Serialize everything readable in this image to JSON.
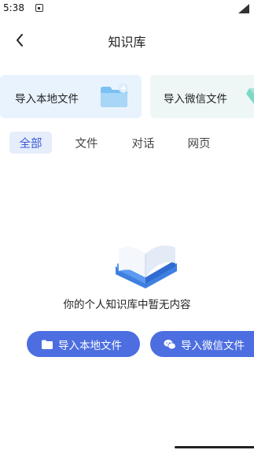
{
  "status_bar": {
    "time": "5:38"
  },
  "header": {
    "title": "知识库"
  },
  "import_cards": {
    "local_label": "导入本地文件",
    "wechat_label": "导入微信文件"
  },
  "tabs": [
    {
      "label": "全部",
      "selected": true
    },
    {
      "label": "文件",
      "selected": false
    },
    {
      "label": "对话",
      "selected": false
    },
    {
      "label": "网页",
      "selected": false
    }
  ],
  "empty_state": {
    "message": "你的个人知识库中暂无内容",
    "local_button": "导入本地文件",
    "wechat_button": "导入微信文件"
  },
  "colors": {
    "accent": "#4c6ee0",
    "tab_selected_bg": "#e6edfb",
    "tab_selected_text": "#3b5bd6",
    "card_local_bg": "#e9f3fd",
    "card_wechat_bg": "#eef7f6"
  },
  "icons": {
    "back": "chevron-left-icon",
    "card_local": "folder-plus-icon",
    "card_wechat": "wechat-gem-icon",
    "empty": "open-book-icon",
    "button_local": "folder-icon",
    "button_wechat": "wechat-icon"
  }
}
